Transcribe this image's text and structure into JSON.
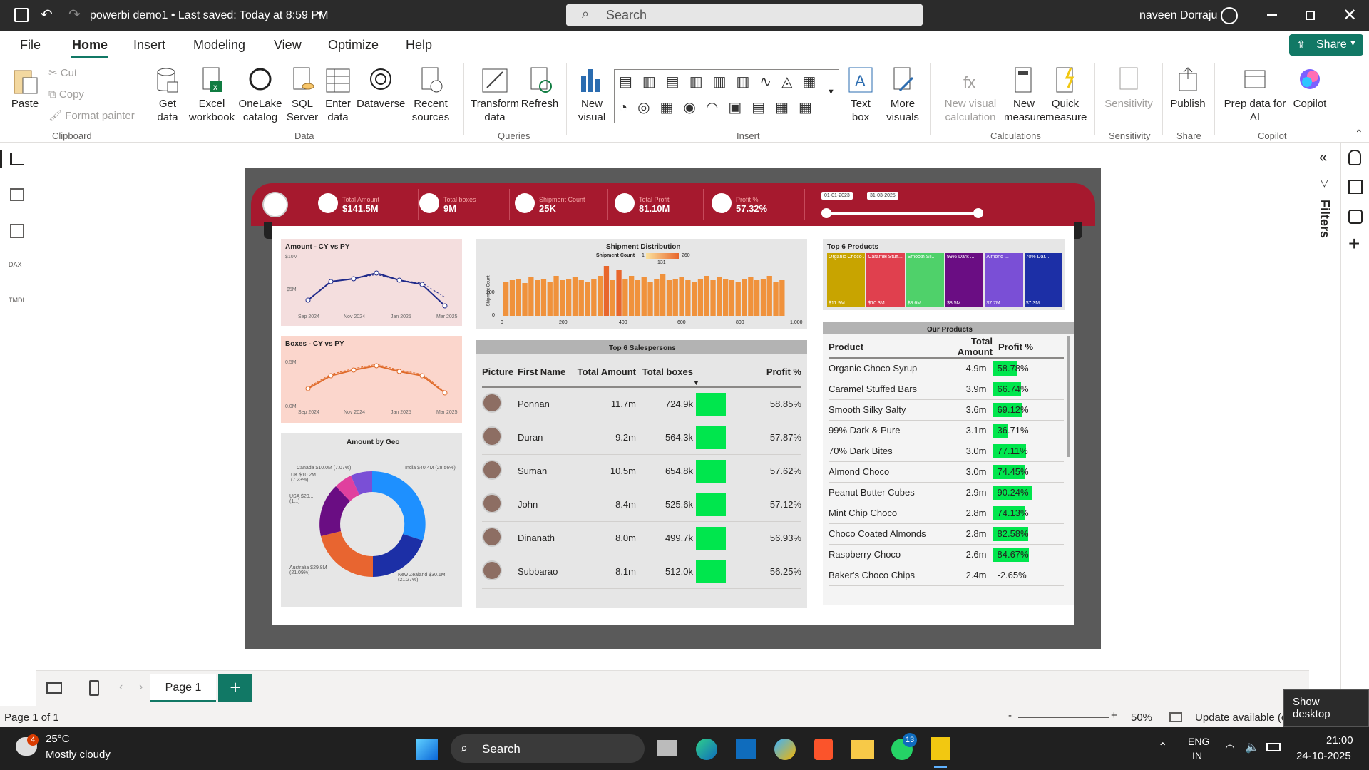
{
  "title_bar": {
    "file_name": "powerbi demo1 • Last saved: Today at 8:59 PM",
    "search_placeholder": "Search",
    "user": "naveen Dorraju"
  },
  "menu": [
    "File",
    "Home",
    "Insert",
    "Modeling",
    "View",
    "Optimize",
    "Help"
  ],
  "share_label": "Share",
  "ribbon": {
    "clipboard": {
      "paste": "Paste",
      "cut": "Cut",
      "copy": "Copy",
      "format_painter": "Format painter",
      "group": "Clipboard"
    },
    "data": {
      "get_data": "Get data",
      "excel": "Excel workbook",
      "onelake": "OneLake catalog",
      "sql": "SQL Server",
      "enter": "Enter data",
      "dataverse": "Dataverse",
      "recent": "Recent sources",
      "group": "Data"
    },
    "queries": {
      "transform": "Transform data",
      "refresh": "Refresh",
      "group": "Queries"
    },
    "insert": {
      "new_visual": "New visual",
      "text_box": "Text box",
      "more_visuals": "More visuals",
      "group": "Insert"
    },
    "calculations": {
      "new_visual_calc": "New visual calculation",
      "new_measure": "New measure",
      "quick_measure": "Quick measure",
      "group": "Calculations"
    },
    "sensitivity": {
      "label": "Sensitivity",
      "group": "Sensitivity"
    },
    "share": {
      "publish": "Publish",
      "group": "Share"
    },
    "copilot": {
      "prep": "Prep data for AI",
      "copilot": "Copilot",
      "group": "Copilot"
    }
  },
  "filters_label": "Filters",
  "report": {
    "kpis": [
      {
        "label": "Total Amount",
        "value": "$141.5M"
      },
      {
        "label": "Total boxes",
        "value": "9M"
      },
      {
        "label": "Shipment Count",
        "value": "25K"
      },
      {
        "label": "Total Profit",
        "value": "81.10M"
      },
      {
        "label": "Profit %",
        "value": "57.32%"
      }
    ],
    "date_start": "01-01-2023",
    "date_end": "31-03-2025",
    "amount_chart": {
      "title": "Amount - CY vs PY",
      "y_top": "$10M",
      "y_mid": "$5M",
      "x_ticks": [
        "Sep 2024",
        "Nov 2024",
        "Jan 2025",
        "Mar 2025"
      ]
    },
    "boxes_chart": {
      "title": "Boxes - CY vs PY",
      "y_top": "0.5M",
      "y_bottom": "0.0M",
      "x_ticks": [
        "Sep 2024",
        "Nov 2024",
        "Jan 2025",
        "Mar 2025"
      ]
    },
    "geo_chart": {
      "title": "Amount by Geo",
      "labels": [
        "Canada $10.0M (7.07%)",
        "UK $10.2M (7.23%)",
        "USA $20... (1...)",
        "India $40.4M (28.56%)",
        "Australia $29.8M (21.09%)",
        "New Zealand $30.1M (21.27%)"
      ]
    },
    "shipment_chart": {
      "title": "Shipment Distribution",
      "legend": "Shipment Count",
      "legend_min": "1",
      "legend_max": "260",
      "legend_mid": "131",
      "y_label": "Shipment Count",
      "y_ticks": [
        "0",
        "200"
      ],
      "x_ticks": [
        "0",
        "200",
        "400",
        "600",
        "800",
        "1,000"
      ]
    },
    "top_products": {
      "title": "Top 6 Products",
      "items": [
        {
          "name": "Organic Choco ...",
          "value": "$11.9M",
          "color": "#c8a400"
        },
        {
          "name": "Caramel Stuff...",
          "value": "$10.3M",
          "color": "#e0404e"
        },
        {
          "name": "Smooth Sil...",
          "value": "$8.6M",
          "color": "#4fd16a"
        },
        {
          "name": "99% Dark ...",
          "value": "$8.5M",
          "color": "#6a0d83"
        },
        {
          "name": "Almond ...",
          "value": "$7.7M",
          "color": "#7a4fd6"
        },
        {
          "name": "70% Dar...",
          "value": "$7.3M",
          "color": "#1c2fa6"
        }
      ]
    },
    "salespersons": {
      "title": "Top 6 Salespersons",
      "headers": [
        "Picture",
        "First Name",
        "Total Amount",
        "Total boxes",
        "",
        "Profit %"
      ],
      "rows": [
        {
          "name": "Ponnan",
          "amount": "11.7m",
          "boxes": "724.9k",
          "profit": "58.85%"
        },
        {
          "name": "Duran",
          "amount": "9.2m",
          "boxes": "564.3k",
          "profit": "57.87%"
        },
        {
          "name": "Suman",
          "amount": "10.5m",
          "boxes": "654.8k",
          "profit": "57.62%"
        },
        {
          "name": "John",
          "amount": "8.4m",
          "boxes": "525.6k",
          "profit": "57.12%"
        },
        {
          "name": "Dinanath",
          "amount": "8.0m",
          "boxes": "499.7k",
          "profit": "56.93%"
        },
        {
          "name": "Subbarao",
          "amount": "8.1m",
          "boxes": "512.0k",
          "profit": "56.25%"
        }
      ]
    },
    "products": {
      "title": "Our Products",
      "headers": [
        "Product",
        "Total Amount",
        "Profit %"
      ],
      "rows": [
        {
          "name": "Organic Choco Syrup",
          "amount": "4.9m",
          "profit": "58.78%",
          "pct": 0.58
        },
        {
          "name": "Caramel Stuffed Bars",
          "amount": "3.9m",
          "profit": "66.74%",
          "pct": 0.66
        },
        {
          "name": "Smooth Silky Salty",
          "amount": "3.6m",
          "profit": "69.12%",
          "pct": 0.69
        },
        {
          "name": "99% Dark & Pure",
          "amount": "3.1m",
          "profit": "36.71%",
          "pct": 0.36
        },
        {
          "name": "70% Dark Bites",
          "amount": "3.0m",
          "profit": "77.11%",
          "pct": 0.77
        },
        {
          "name": "Almond Choco",
          "amount": "3.0m",
          "profit": "74.45%",
          "pct": 0.74
        },
        {
          "name": "Peanut Butter Cubes",
          "amount": "2.9m",
          "profit": "90.24%",
          "pct": 0.9
        },
        {
          "name": "Mint Chip Choco",
          "amount": "2.8m",
          "profit": "74.13%",
          "pct": 0.74
        },
        {
          "name": "Choco Coated Almonds",
          "amount": "2.8m",
          "profit": "82.58%",
          "pct": 0.82
        },
        {
          "name": "Raspberry Choco",
          "amount": "2.6m",
          "profit": "84.67%",
          "pct": 0.84
        },
        {
          "name": "Baker's Choco Chips",
          "amount": "2.4m",
          "profit": "-2.65%",
          "pct": 0
        }
      ]
    }
  },
  "page_tab": "Page 1",
  "status": {
    "page": "Page 1 of 1",
    "zoom": "50%",
    "update": "Update available (click to download)",
    "tooltip": "Show desktop"
  },
  "taskbar": {
    "temp": "25°C",
    "weather": "Mostly cloudy",
    "weather_badge": "4",
    "search": "Search",
    "lang1": "ENG",
    "lang2": "IN",
    "time": "21:00",
    "date": "24-10-2025",
    "whatsapp_badge": "13"
  }
}
